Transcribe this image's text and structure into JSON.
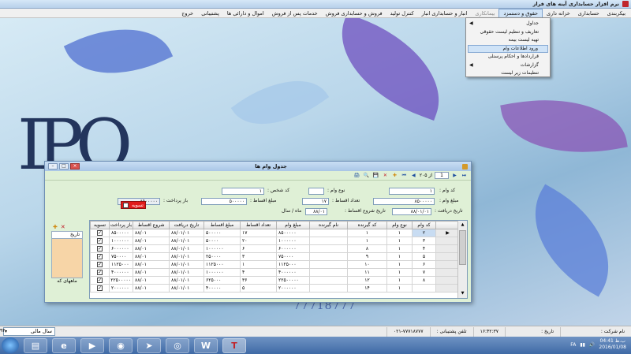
{
  "window": {
    "title": "نرم افزار حسابداری آینه های فراز"
  },
  "menubar": [
    {
      "label": "بیکربندی"
    },
    {
      "label": "حسابداری"
    },
    {
      "label": "خزانه داری"
    },
    {
      "label": "حقوق و دستمزد",
      "active": true
    },
    {
      "label": "بیمانکاری",
      "disabled": true
    },
    {
      "label": "انبار و حسابداری انبار"
    },
    {
      "label": "کنترل تولید"
    },
    {
      "label": "فروش و حسابداری فروش"
    },
    {
      "label": "خدمات پس از فروش"
    },
    {
      "label": "اموال و دارائی ها"
    },
    {
      "label": "پشتیبانی"
    },
    {
      "label": "خروج"
    }
  ],
  "dropdown": [
    {
      "label": "جداول",
      "submenu": true
    },
    {
      "label": "تعاریف و تنظیم لیست حقوقی",
      "submenu": false
    },
    {
      "label": "تهیه لیست بیمه",
      "submenu": false
    },
    {
      "label": "ورود اطلاعات وام",
      "submenu": false,
      "selected": true
    },
    {
      "label": "قراردادها و احکام پرسنلی",
      "submenu": false
    },
    {
      "label": "گزارشات",
      "submenu": true
    },
    {
      "label": "تنظیمات زیر لیست",
      "submenu": false
    }
  ],
  "dialog": {
    "title": "جدول وام ها",
    "nav": {
      "position": "1",
      "count": "از ۲۰۵"
    },
    "fields": {
      "loan_code_label": "کد وام :",
      "loan_code": "۱",
      "loan_type_label": "نوع وام :",
      "loan_type": "",
      "person_code_label": "کد شخص :",
      "person_code": "۱",
      "loan_amount_label": "مبلغ وام :",
      "loan_amount": "۸۵۰۰۰۰۰",
      "installments_label": "تعداد اقساط :",
      "installments": "۱۷",
      "installment_amount_label": "مبلغ اقساط :",
      "installment_amount": "۵۰۰۰۰۰",
      "repayment_label": "باز پرداخت :",
      "repayment": "۸۵۰۰۰۰۰",
      "receive_date_label": "تاریخ دریافت :",
      "receive_date": "۸۸/۰۱/۰۱",
      "start_date_label": "تاریخ شروع اقساط :",
      "start_date": "۸۸/۰۱",
      "month_year_label": "ماه / سال",
      "settled_label": "تسویه"
    },
    "side_panel": {
      "header": "تاریخ",
      "footer": "ماههای که"
    },
    "table": {
      "columns": [
        "کد وام",
        "نوع وام",
        "کد گیرنده",
        "نام گیرنده",
        "مبلغ وام",
        "تعداد اقساط",
        "مبلغ اقساط",
        "تاریخ دریافت",
        "شروع اقساط",
        "باز پرداخت",
        "تسویه"
      ],
      "rows": [
        [
          "۲",
          "۱",
          "۱",
          "",
          "۸۵۰۰۰۰۰",
          "۱۷",
          "۵۰۰۰۰۰",
          "۸۸/۰۱/۰۱",
          "۸۸/۰۱",
          "۸۵۰۰۰۰۰",
          true
        ],
        [
          "۳",
          "۱",
          "۱",
          "",
          "۱۰۰۰۰۰۰",
          "۲۰",
          "۵۰۰۰۰",
          "۸۸/۰۱/۰۱",
          "۸۸/۰۱",
          "۱۰۰۰۰۰۰",
          true
        ],
        [
          "۴",
          "۱",
          "۸",
          "",
          "۶۰۰۰۰۰۰",
          "۶",
          "۱۰۰۰۰۰۰",
          "۸۸/۰۱/۰۱",
          "۸۸/۰۱",
          "۶۰۰۰۰۰۰",
          true
        ],
        [
          "۵",
          "۱",
          "۹",
          "",
          "۷۵۰۰۰۰",
          "۳",
          "۲۵۰۰۰۰",
          "۸۸/۰۱/۰۱",
          "۸۸/۰۱",
          "۷۵۰۰۰۰",
          true
        ],
        [
          "۶",
          "۱",
          "۱۰",
          "",
          "۱۱۲۵۰۰۰",
          "۱",
          "۱۱۲۵۰۰۰",
          "۸۸/۰۱/۰۱",
          "۸۸/۰۱",
          "۱۱۲۵۰۰۰",
          true
        ],
        [
          "۷",
          "۱",
          "۱۱",
          "",
          "۴۰۰۰۰۰۰",
          "۴",
          "۱۰۰۰۰۰۰",
          "۸۸/۰۱/۰۱",
          "۸۸/۰۱",
          "۴۰۰۰۰۰۰",
          true
        ],
        [
          "۸",
          "۱",
          "۱۲",
          "",
          "۲۲۵۰۰۰۰۰",
          "۳۶",
          "۶۲۵۰۰۰",
          "۸۸/۰۱/۰۱",
          "۸۸/۰۱",
          "۲۲۵۰۰۰۰۰",
          true
        ],
        [
          "",
          "۱",
          "۱۴",
          "",
          "۲۰۰۰۰۰۰",
          "۵",
          "۴۰۰۰۰۰",
          "۸۸/۰۱/۰۱",
          "۸۸/۰۱",
          "۲۰۰۰۰۰۰",
          true
        ]
      ]
    }
  },
  "desktop": {
    "logo": "IPO",
    "phone": "77718777"
  },
  "statusbar": {
    "company_label": "نام شرکت :",
    "date_label": "تاریخ :",
    "time": "۱۶:۴۲:۳۷",
    "support_label": "تلفن پشتیبانی :",
    "support_phone": "۰۲۱-۷۷۷۱۸۷۷۷",
    "year_select": "سال مالی",
    "year_value": "۹۳"
  },
  "taskbar": {
    "lang": "FA",
    "time": "04:41 ب.ظ",
    "date": "2016/01/08",
    "icons": [
      "explorer-icon",
      "ie-icon",
      "media-player-icon",
      "chrome-icon",
      "telegram-icon",
      "disk-icon",
      "word-icon",
      "app-t-icon"
    ]
  },
  "colors": {
    "dialog_bg": "#dff0d6",
    "accent": "#cfe3f7",
    "chip": "#e11b1b",
    "side_panel": "#f7d5a7"
  }
}
